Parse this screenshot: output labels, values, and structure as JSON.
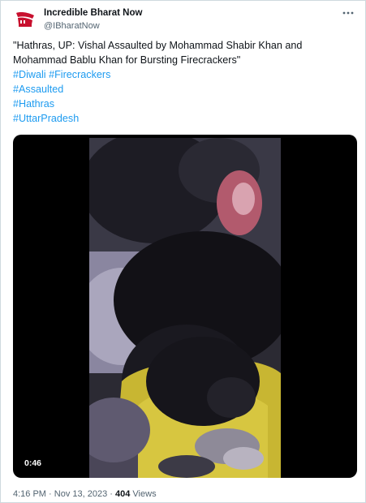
{
  "author": {
    "display_name": "Incredible Bharat Now",
    "handle": "@IBharatNow",
    "avatar_icon": "bharat-logo-icon"
  },
  "more_icon": "more-horizontal-icon",
  "tweet": {
    "text_line1": "\"Hathras, UP: Vishal Assaulted by Mohammad Shabir Khan and",
    "text_line2": "Mohammad Bablu Khan for Bursting Firecrackers\"",
    "hashtags": [
      "#Diwali",
      "#Firecrackers",
      "#Assaulted",
      "#Hathras",
      "#UttarPradesh"
    ]
  },
  "media": {
    "type": "video",
    "duration": "0:46"
  },
  "meta": {
    "time": "4:16 PM",
    "separator": "·",
    "date": "Nov 13, 2023",
    "views_count": "404",
    "views_label": "Views"
  },
  "colors": {
    "hashtag": "#1d9bf0",
    "text": "#0f1419",
    "secondary": "#536471",
    "border": "#cfd9de",
    "avatar_red": "#c8102e"
  }
}
